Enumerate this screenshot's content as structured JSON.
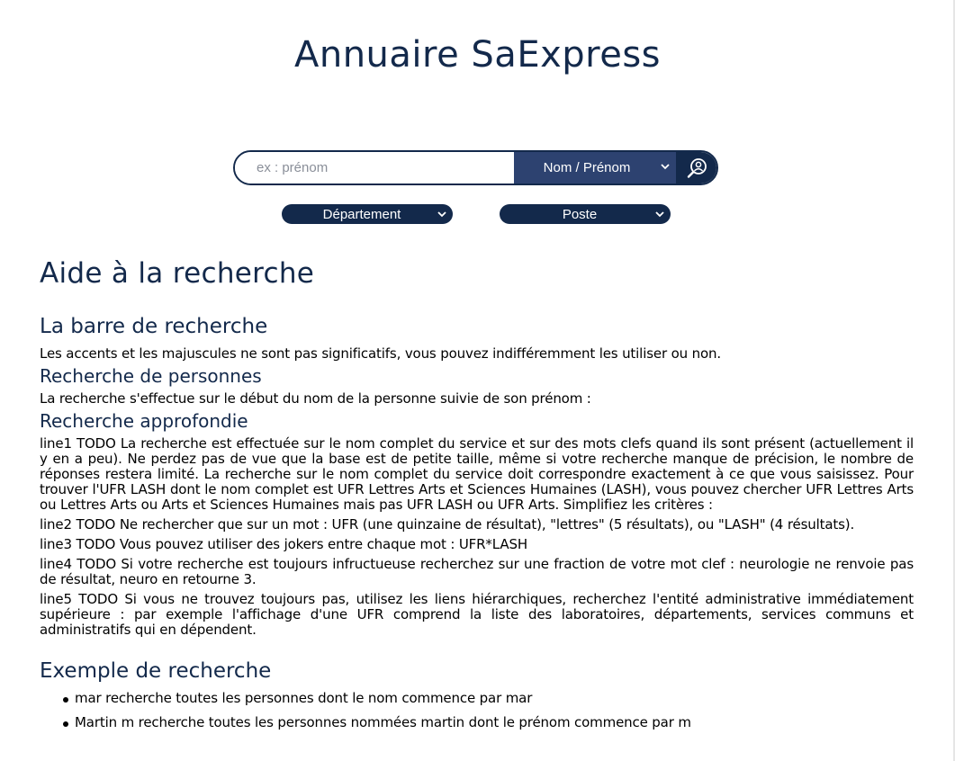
{
  "header": {
    "title": "Annuaire SaExpress"
  },
  "search": {
    "placeholder": "ex : prénom",
    "type_selected": "Nom / Prénom"
  },
  "filters": {
    "department": "Département",
    "poste": "Poste"
  },
  "help": {
    "title": "Aide à la recherche",
    "bar_title": "La barre de recherche",
    "bar_text": "Les accents et les majuscules ne sont pas significatifs, vous pouvez indifféremment les utiliser ou non.",
    "persons_title": "Recherche de personnes",
    "persons_text": "La recherche s'effectue sur le début du nom de la personne suivie de son prénom :",
    "advanced_title": "Recherche approfondie",
    "lines": [
      "line1 TODO La recherche est effectuée sur le nom complet du service et sur des mots clefs quand ils sont présent (actuellement il y en a peu). Ne perdez pas de vue que la base est de petite taille, même si votre recherche manque de précision, le nombre de réponses restera limité. La recherche sur le nom complet du service doit correspondre exactement à ce que vous saisissez. Pour trouver l'UFR LASH dont le nom complet est UFR Lettres Arts et Sciences Humaines (LASH), vous pouvez chercher UFR Lettres Arts ou Lettres Arts ou Arts et Sciences Humaines mais pas UFR LASH ou UFR Arts. Simplifiez les critères :",
      "line2 TODO Ne rechercher que sur un mot : UFR (une quinzaine de résultat), \"lettres\" (5 résultats), ou \"LASH\" (4 résultats).",
      "line3 TODO Vous pouvez utiliser des jokers entre chaque mot : UFR*LASH",
      "line4 TODO Si votre recherche est toujours infructueuse recherchez sur une fraction de votre mot clef : neurologie ne renvoie pas de résultat, neuro en retourne 3.",
      "line5 TODO Si vous ne trouvez toujours pas, utilisez les liens hiérarchiques, recherchez l'entité administrative immédiatement supérieure : par exemple l'affichage d'une UFR comprend la liste des laboratoires, départements, services communs et administratifs qui en dépendent."
    ],
    "examples_title": "Exemple de recherche",
    "examples": [
      "mar recherche toutes les personnes dont le nom commence par mar",
      "Martin m recherche toutes les personnes nommées martin dont le prénom commence par m"
    ]
  },
  "colors": {
    "primary": "#13294b",
    "select_bg": "#2d4270"
  }
}
